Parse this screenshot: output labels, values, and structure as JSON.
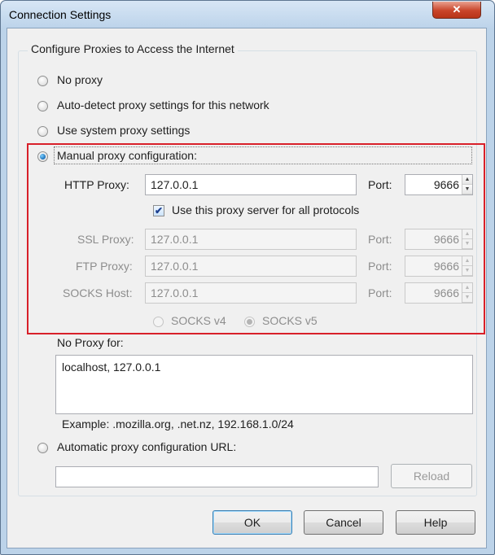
{
  "window": {
    "title": "Connection Settings",
    "close_glyph": "✕"
  },
  "group": {
    "title": "Configure Proxies to Access the Internet"
  },
  "options": {
    "no_proxy": "No proxy",
    "auto_detect": "Auto-detect proxy settings for this network",
    "system_proxy": "Use system proxy settings",
    "manual": "Manual proxy configuration:",
    "auto_url": "Automatic proxy configuration URL:"
  },
  "http": {
    "label": "HTTP Proxy:",
    "value": "127.0.0.1",
    "port_label": "Port:",
    "port": "9666"
  },
  "use_for_all": {
    "label": "Use this proxy server for all protocols",
    "checked": true
  },
  "ssl": {
    "label": "SSL Proxy:",
    "value": "127.0.0.1",
    "port_label": "Port:",
    "port": "9666"
  },
  "ftp": {
    "label": "FTP Proxy:",
    "value": "127.0.0.1",
    "port_label": "Port:",
    "port": "9666"
  },
  "socks": {
    "label": "SOCKS Host:",
    "value": "127.0.0.1",
    "port_label": "Port:",
    "port": "9666"
  },
  "socks_versions": {
    "v4": "SOCKS v4",
    "v5": "SOCKS v5"
  },
  "no_proxy_for": {
    "label": "No Proxy for:",
    "value": "localhost, 127.0.0.1",
    "example": "Example: .mozilla.org, .net.nz, 192.168.1.0/24"
  },
  "auto_url_value": "",
  "buttons": {
    "reload": "Reload",
    "ok": "OK",
    "cancel": "Cancel",
    "help": "Help"
  },
  "spinner": {
    "up": "▲",
    "down": "▼"
  },
  "check_glyph": "✔",
  "colors": {
    "highlight": "#d8202a",
    "titlebar": "#bcd3e9",
    "close": "#c9452a"
  }
}
